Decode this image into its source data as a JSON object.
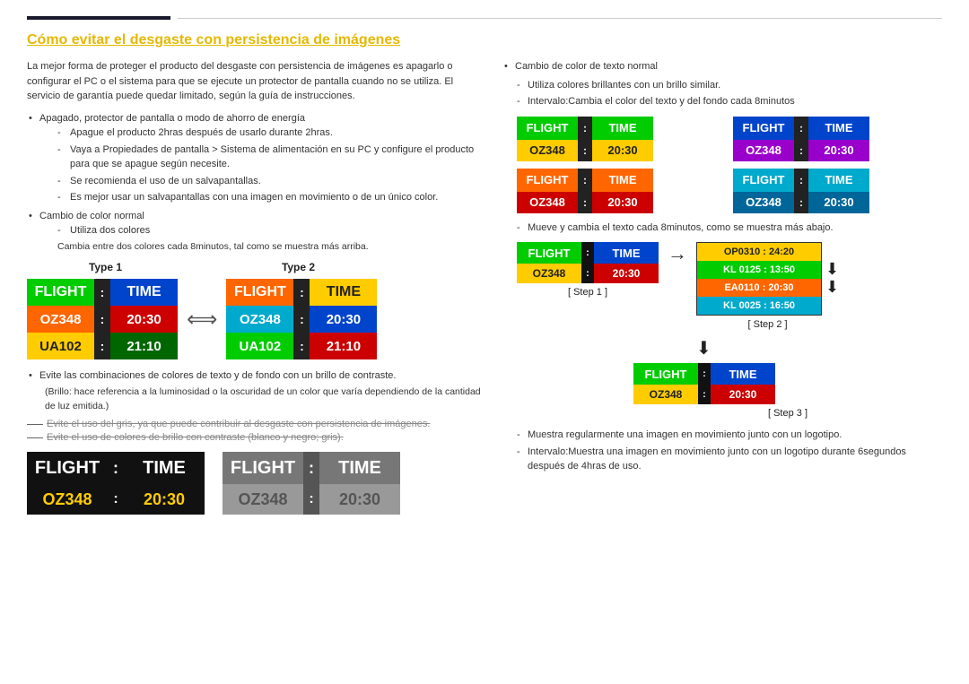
{
  "page": {
    "title": "Cómo evitar el desgaste con persistencia de imágenes",
    "top_border_note": ""
  },
  "left": {
    "intro": "La mejor forma de proteger el producto del desgaste con persistencia de imágenes es apagarlo o configurar el PC o el sistema para que se ejecute un protector de pantalla cuando no se utiliza. El servicio de garantía puede quedar limitado, según la guía de instrucciones.",
    "bullet1_title": "Apagado, protector de pantalla o modo de ahorro de energía",
    "dash1": "Apague el producto 2hras después de usarlo durante 2hras.",
    "dash2": "Vaya a Propiedades de pantalla > Sistema de alimentación en su PC y configure el producto para que se apague según necesite.",
    "dash3": "Se recomienda el uso de un salvapantallas.",
    "dash4": "Es mejor usar un salvapantallas con una imagen en movimiento o de un único color.",
    "bullet2_title": "Cambio de color normal",
    "dash5": "Utiliza dos colores",
    "note1": "Cambia entre dos colores cada 8minutos, tal como se muestra más arriba.",
    "type1_label": "Type 1",
    "type2_label": "Type 2",
    "board1": {
      "flight": "FLIGHT",
      "colon": ":",
      "time": "TIME",
      "oz": "OZ348",
      "c2": ":",
      "val": "20:30",
      "ua": "UA102",
      "c3": ":",
      "val2": "21:10"
    },
    "board2": {
      "flight": "FLIGHT",
      "colon": ":",
      "time": "TIME",
      "oz": "OZ348",
      "c2": ":",
      "val": "20:30",
      "ua": "UA102",
      "c3": ":",
      "val2": "21:10"
    },
    "avoid_note1": "Evite las combinaciones de colores de texto y de fondo con un brillo de contraste.",
    "avoid_note2": "(Brillo: hace referencia a la luminosidad o la oscuridad de un color que varía dependiendo de la cantidad de luz emitida.)",
    "strikethrough1": "Evite el uso del gris, ya que puede contribuir al desgaste con persistencia de imágenes.",
    "strikethrough2": "Evite el uso de colores de brillo con contraste (blanco y negro; gris).",
    "bottom_board1": {
      "flight": "FLIGHT",
      "colon": ":",
      "time": "TIME",
      "oz": "OZ348",
      "c2": ":",
      "val": "20:30"
    },
    "bottom_board2": {
      "flight": "FLIGHT",
      "colon": ":",
      "time": "TIME",
      "oz": "OZ348",
      "c2": ":",
      "val": "20:30"
    }
  },
  "right": {
    "bullet1": "Cambio de color de texto normal",
    "dash1": "Utiliza colores brillantes con un brillo similar.",
    "dash2": "Intervalo:Cambia el color del texto y del fondo cada 8minutos",
    "color_boards": {
      "bva": {
        "flight": "FLIGHT",
        "colon": ":",
        "time": "TIME",
        "oz": "OZ348",
        "c2": ":",
        "val": "20:30"
      },
      "bvb": {
        "flight": "FLIGHT",
        "colon": ":",
        "time": "TIME",
        "oz": "OZ348",
        "c2": ":",
        "val": "20:30"
      },
      "bvc": {
        "flight": "FLIGHT",
        "colon": ":",
        "time": "TIME",
        "oz": "OZ348",
        "c2": ":",
        "val": "20:30"
      },
      "bvd": {
        "flight": "FLIGHT",
        "colon": ":",
        "time": "TIME",
        "oz": "OZ348",
        "c2": ":",
        "val": "20:30"
      }
    },
    "move_note": "Mueve y cambia el texto cada 8minutos, como se muestra más abajo.",
    "step_section": {
      "step1_label": "[ Step 1 ]",
      "step2_label": "[ Step 2 ]",
      "step3_label": "[ Step 3 ]",
      "step1_board": {
        "flight": "FLIGHT",
        "colon": ":",
        "time": "TIME",
        "oz": "OZ348",
        "c2": ":",
        "val": "20:30"
      },
      "step2_lines": [
        {
          "text": "OP0310 : 24:20",
          "color": "#ffcc00"
        },
        {
          "text": "KL 0125 : 13:50",
          "color": "#00cc00"
        },
        {
          "text": "EA0110 : 20:30",
          "color": "#ff6600"
        },
        {
          "text": "KL 0025 : 16:50",
          "color": "#00aacc"
        }
      ],
      "step3_board": {
        "flight": "FLIGHT",
        "colon": ":",
        "time": "TIME",
        "oz": "OZ348",
        "c2": ":",
        "val": "20:30"
      }
    },
    "moving_note": "Muestra regularmente una imagen en movimiento junto con un logotipo.",
    "interval_note": "Intervalo:Muestra una imagen en movimiento junto con un logotipo durante 6segundos después de 4hras de uso."
  }
}
